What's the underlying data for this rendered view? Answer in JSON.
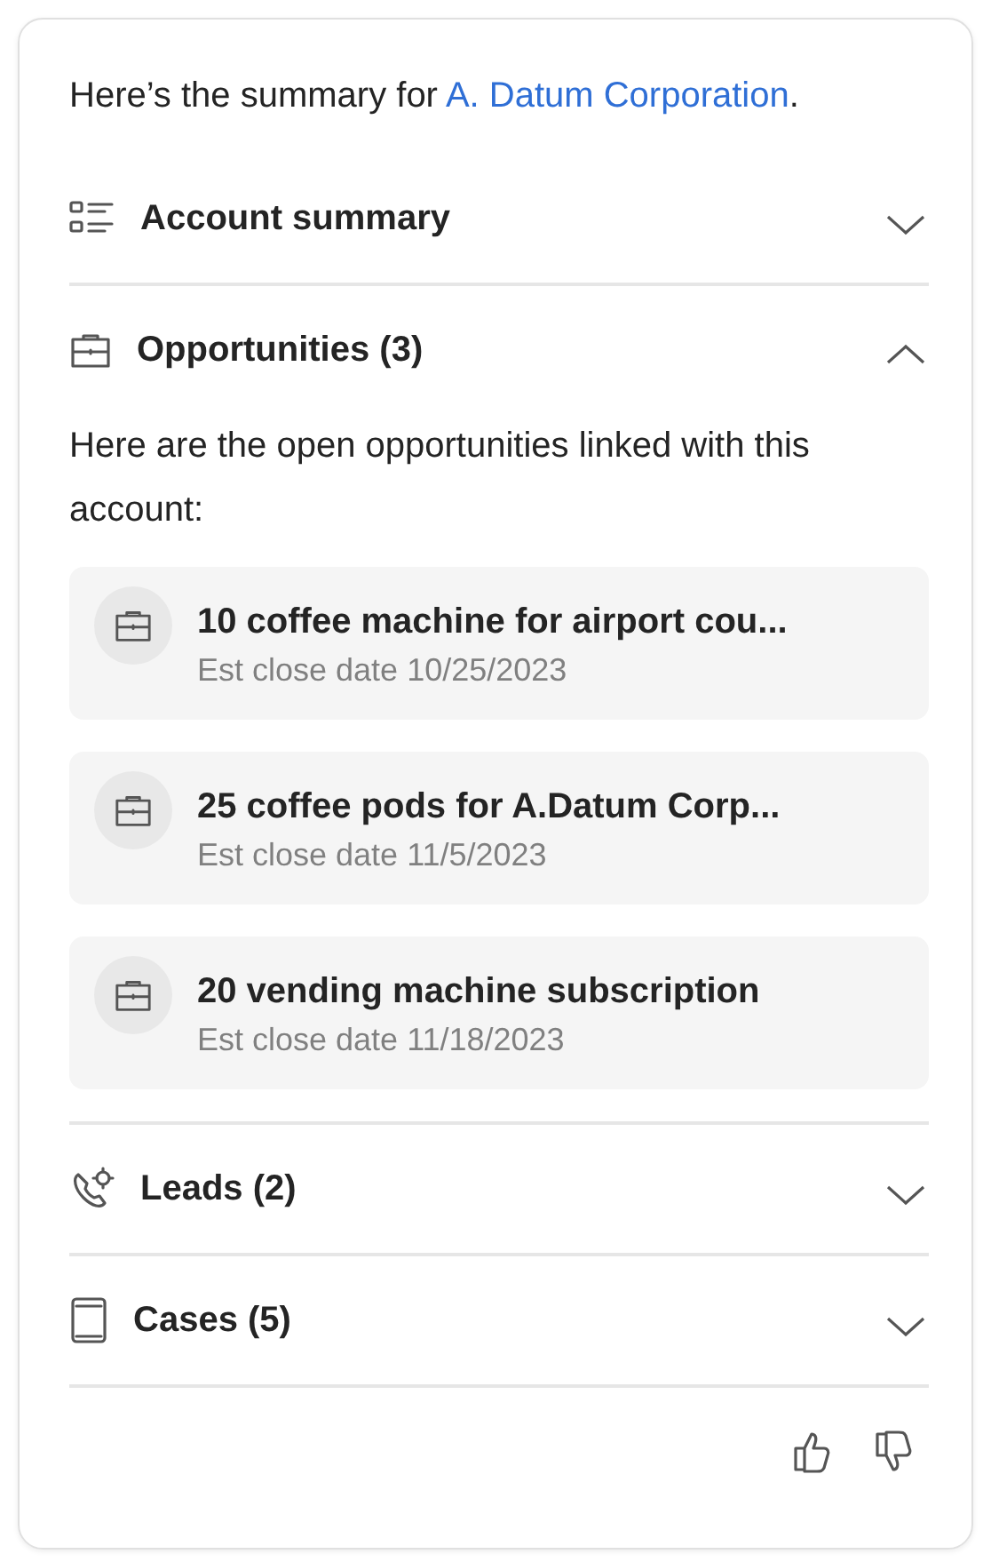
{
  "intro": {
    "text": "Here’s the summary for ",
    "link": "A. Datum Corporation",
    "end": "."
  },
  "sections": [
    {
      "kind": "list",
      "title": "Account summary",
      "expanded": false
    },
    {
      "kind": "briefcase",
      "title": "Opportunities (3)",
      "expanded": true,
      "description": "Here are the open opportunities linked with this account:",
      "items": [
        {
          "title": "10 coffee machine for airport cou...",
          "subtitle": "Est close date 10/25/2023"
        },
        {
          "title": "25 coffee pods for A.Datum Corp...",
          "subtitle": "Est close date 11/5/2023"
        },
        {
          "title": "20 vending machine subscription",
          "subtitle": "Est close date 11/18/2023"
        }
      ]
    },
    {
      "kind": "phone",
      "title": "Leads (2)",
      "expanded": false
    },
    {
      "kind": "case",
      "title": "Cases (5)",
      "expanded": false
    }
  ],
  "feedback": [
    {
      "kind": "like"
    },
    {
      "kind": "dislike"
    }
  ]
}
